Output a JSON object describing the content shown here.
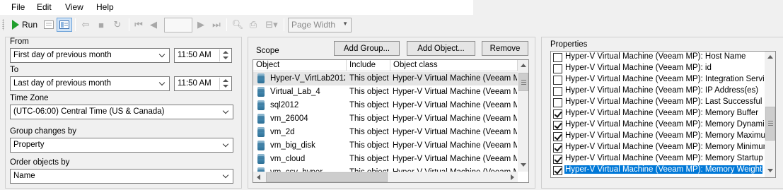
{
  "menu": [
    "File",
    "Edit",
    "View",
    "Help"
  ],
  "toolbar": {
    "run_label": "Run",
    "page_number": "",
    "zoom": "Page Width"
  },
  "left": {
    "from_label": "From",
    "from_value": "First day of previous month",
    "from_time": "11:50 AM",
    "to_label": "To",
    "to_value": "Last day of previous month",
    "to_time": "11:50 AM",
    "timezone_label": "Time Zone",
    "timezone_value": "(UTC-06:00) Central Time (US & Canada)",
    "group_label": "Group changes by",
    "group_value": "Property",
    "order_label": "Order objects by",
    "order_value": "Name"
  },
  "scope": {
    "label": "Scope",
    "add_group": "Add Group...",
    "add_object": "Add Object...",
    "remove": "Remove",
    "columns": [
      "Object",
      "Include",
      "Object class"
    ],
    "rows": [
      {
        "object": "Hyper-V_VirtLab2012",
        "include": "This object",
        "class": "Hyper-V Virtual Machine (Veeam MP)"
      },
      {
        "object": "Virtual_Lab_4",
        "include": "This object",
        "class": "Hyper-V Virtual Machine (Veeam MP)"
      },
      {
        "object": "sql2012",
        "include": "This object",
        "class": "Hyper-V Virtual Machine (Veeam MP)"
      },
      {
        "object": "vm_26004",
        "include": "This object",
        "class": "Hyper-V Virtual Machine (Veeam MP)"
      },
      {
        "object": "vm_2d",
        "include": "This object",
        "class": "Hyper-V Virtual Machine (Veeam MP)"
      },
      {
        "object": "vm_big_disk",
        "include": "This object",
        "class": "Hyper-V Virtual Machine (Veeam MP)"
      },
      {
        "object": "vm_cloud",
        "include": "This object",
        "class": "Hyper-V Virtual Machine (Veeam MP)"
      },
      {
        "object": "vm_csv_hyper",
        "include": "This object",
        "class": "Hyper-V Virtual Machine (Veeam MP)"
      }
    ]
  },
  "properties": {
    "label": "Properties",
    "items": [
      {
        "text": "Hyper-V Virtual Machine (Veeam MP): Host Name",
        "checked": false
      },
      {
        "text": "Hyper-V Virtual Machine (Veeam MP): id",
        "checked": false
      },
      {
        "text": "Hyper-V Virtual Machine (Veeam MP): Integration Services",
        "checked": false
      },
      {
        "text": "Hyper-V Virtual Machine (Veeam MP): IP Address(es)",
        "checked": false
      },
      {
        "text": "Hyper-V Virtual Machine (Veeam MP): Last Successful Backup",
        "checked": false
      },
      {
        "text": "Hyper-V Virtual Machine (Veeam MP): Memory Buffer",
        "checked": true
      },
      {
        "text": "Hyper-V Virtual Machine (Veeam MP): Memory Dynamic",
        "checked": true
      },
      {
        "text": "Hyper-V Virtual Machine (Veeam MP): Memory Maximum MB",
        "checked": true
      },
      {
        "text": "Hyper-V Virtual Machine (Veeam MP): Memory Minimum MB",
        "checked": true
      },
      {
        "text": "Hyper-V Virtual Machine (Veeam MP): Memory Startup MB",
        "checked": true
      },
      {
        "text": "Hyper-V Virtual Machine (Veeam MP): Memory Weight",
        "checked": true
      }
    ]
  }
}
